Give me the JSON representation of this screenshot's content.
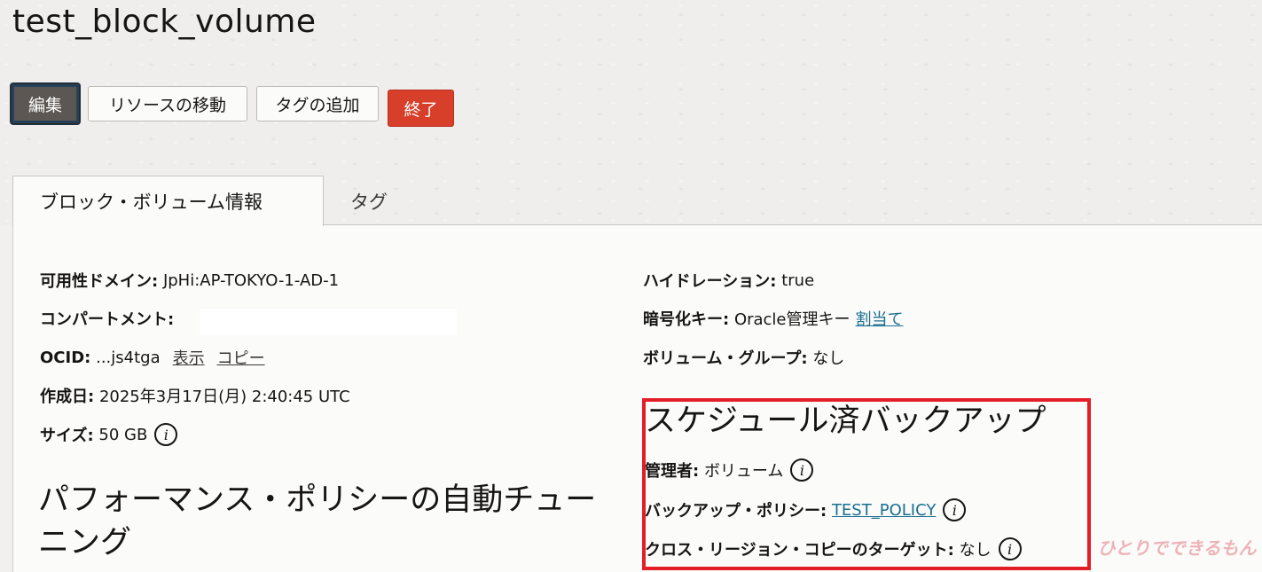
{
  "page": {
    "title": "test_block_volume"
  },
  "toolbar": {
    "edit_label": "編集",
    "move_label": "リソースの移動",
    "add_tag_label": "タグの追加",
    "terminate_label": "終了"
  },
  "tabs": [
    {
      "label": "ブロック・ボリューム情報",
      "active": true
    },
    {
      "label": "タグ",
      "active": false
    }
  ],
  "left": {
    "availability_domain": {
      "label": "可用性ドメイン:",
      "value": "JpHi:AP-TOKYO-1-AD-1"
    },
    "compartment": {
      "label": "コンパートメント:",
      "value": ""
    },
    "ocid": {
      "label": "OCID:",
      "value": "...js4tga",
      "show": "表示",
      "copy": "コピー"
    },
    "created": {
      "label": "作成日:",
      "value": "2025年3月17日(月) 2:40:45 UTC"
    },
    "size": {
      "label": "サイズ:",
      "value": "50 GB"
    },
    "perf_heading": "パフォーマンス・ポリシーの自動チュー",
    "perf_heading_2": "ニング"
  },
  "right": {
    "hydration": {
      "label": "ハイドレーション:",
      "value": "true"
    },
    "encryption": {
      "label": "暗号化キー:",
      "value": "Oracle管理キー",
      "link": "割当て"
    },
    "volume_group": {
      "label": "ボリューム・グループ:",
      "value": "なし"
    },
    "backup_heading": "スケジュール済バックアップ",
    "manager": {
      "label": "管理者:",
      "value": "ボリューム"
    },
    "backup_policy": {
      "label": "バックアップ・ポリシー:",
      "value": "TEST_POLICY"
    },
    "cross_region": {
      "label": "クロス・リージョン・コピーのターゲット:",
      "value": "なし"
    }
  },
  "icons": {
    "info": "i"
  },
  "watermark": "ひとりでできるもん",
  "colors": {
    "terminate": "#d73f2b",
    "link": "#1a6f8f",
    "highlight": "#e31e26"
  }
}
